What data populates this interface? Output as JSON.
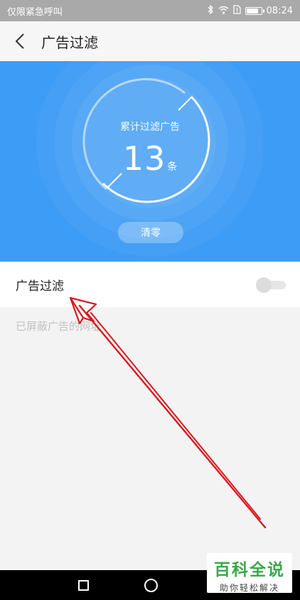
{
  "status_bar": {
    "carrier_text": "仅限紧急呼叫",
    "time": "08:24",
    "battery_level": 0.85
  },
  "header": {
    "title": "广告过滤",
    "back_icon": "chevron-left-icon"
  },
  "hero": {
    "counter_label": "累计过滤广告",
    "counter_value": "13",
    "counter_unit": "条",
    "clear_button_label": "清零",
    "background_color": "#3d9cf5"
  },
  "settings": {
    "ad_filter_label": "广告过滤",
    "ad_filter_enabled": false,
    "blocked_list_heading": "已屏蔽广告的网址"
  },
  "annotation": {
    "arrow_color": "#d9191e"
  },
  "watermark": {
    "main": "百科全说",
    "sub": "助你轻松解决"
  }
}
